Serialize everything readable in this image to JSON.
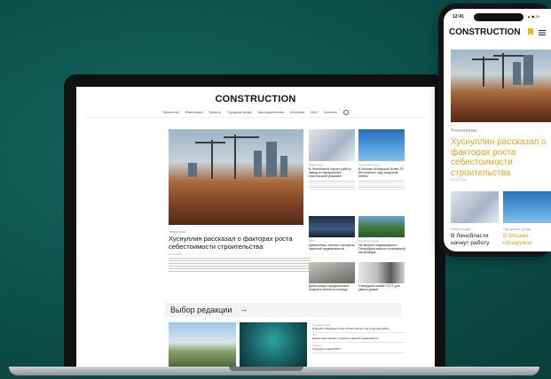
{
  "site": {
    "logo": "CONSTRUCTION",
    "nav": [
      "Технологии",
      "Инвестиции",
      "Проекты",
      "Городская среда",
      "Законодательство",
      "Интервью",
      "ЖКХ",
      "Контакты"
    ],
    "hero": {
      "category": "Технологии",
      "title": "Хуснуллин рассказал о факторах роста себестоимости строительства",
      "date": "22.03.2024"
    },
    "cards": [
      {
        "category": "Инвестиции",
        "title": "В Ленобласти начнут работу завод по переработке пластиковой упаковки"
      },
      {
        "category": "Городская среда",
        "title": "В Москве обнаружат более 20 бесплатных под открытым небом"
      },
      {
        "category": "ЖКХ",
        "title": "Девелоперы меняют портфель офисной недвижимости"
      },
      {
        "category": "Городская среда",
        "title": "Не меняют недвижимости Петербурга вышла популярный застройщик"
      },
      {
        "category": "Проекты",
        "title": "Девелоперы предпочитают покупать землю в столице"
      },
      {
        "category": "Технологии",
        "title": "Утвердили новый ГОСТ для умных домов"
      }
    ],
    "editors_choice": {
      "title": "Выбор редакции",
      "arrow": "→",
      "list": [
        {
          "category": "Городская среда",
          "title": "В Москве обнаружат более 20 бесплатных под открытым небом"
        },
        {
          "category": "ЖКХ",
          "title": "Девелоперы меняют портфель офисной недвижимости"
        },
        {
          "category": "Проекты",
          "title": "Утвердили новый ГОСТ"
        }
      ]
    }
  },
  "phone": {
    "time": "12:41",
    "status_right": "▲ ◆ 29",
    "logo": "CONSTRUCTION",
    "hero_category": "Технологии",
    "hero_title": "Хуснуллин рассказал о факторах роста себестоимости строительства",
    "hero_date": "22.03.2024",
    "cards": [
      {
        "category": "Инвестиции",
        "title": "В Ленобласти начнут работу"
      },
      {
        "category": "Городская среда",
        "title": "В Москве обнаружат"
      }
    ]
  },
  "colors": {
    "background": "#0c4f49",
    "accent": "#e1a21c",
    "bookmark": "#f1b400"
  },
  "icons": [
    "search-icon",
    "bookmark-icon",
    "menu-icon",
    "arrow-right-icon"
  ]
}
